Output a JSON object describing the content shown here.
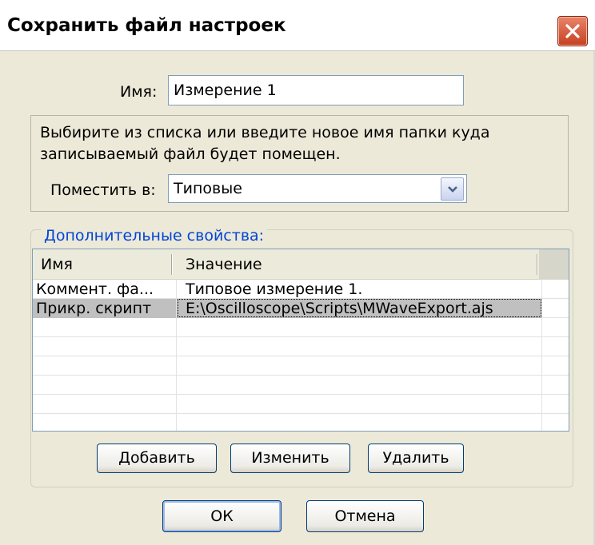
{
  "window": {
    "title": "Сохранить файл настроек"
  },
  "name_field": {
    "label": "Имя:",
    "value": "Измерение 1"
  },
  "folder": {
    "hint": "Выбирите из списка или введите новое имя папки куда записываемый файл будет помещен.",
    "hint_line1": "Выбирите из списка или введите новое имя папки куда",
    "hint_line2": "записываемый файл будет помещен.",
    "label": "Поместить в:",
    "value": "Типовые"
  },
  "properties": {
    "group_title": "Дополнительные свойства:",
    "columns": [
      "Имя",
      "Значение"
    ],
    "rows": [
      {
        "name": "Коммент. фа...",
        "value": "Типовое измерение 1."
      },
      {
        "name": "Прикр. скрипт",
        "value": "E:\\Oscilloscope\\Scripts\\MWaveExport.ajs"
      }
    ],
    "selected_row": 1,
    "buttons": {
      "add": "Добавить",
      "edit": "Изменить",
      "delete": "Удалить"
    }
  },
  "footer": {
    "ok": "ОК",
    "cancel": "Отмена"
  },
  "colors": {
    "dialog_bg": "#ece9d8",
    "close_button": "#c64020",
    "group_title": "#0046d5",
    "selection": "#c0c0c0"
  },
  "icons": [
    "close-icon",
    "chevron-down-icon"
  ]
}
